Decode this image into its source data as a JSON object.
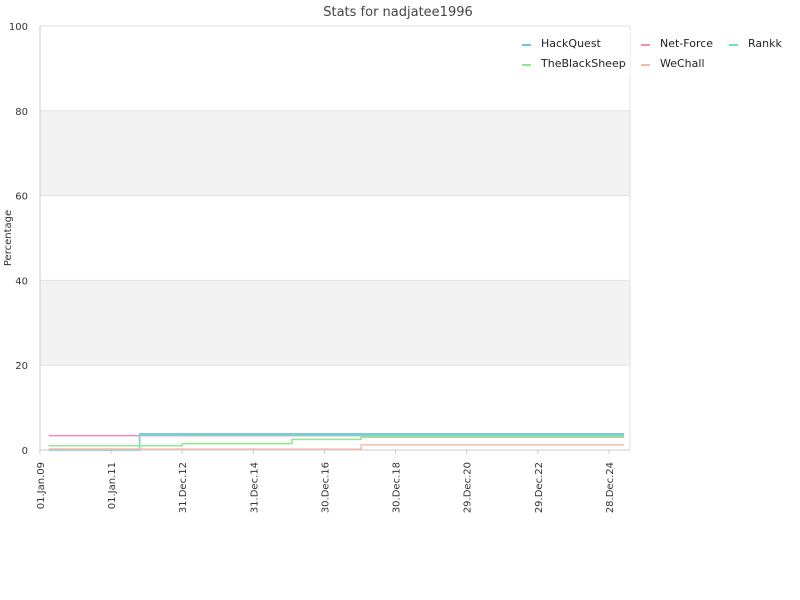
{
  "chart_data": {
    "type": "line",
    "title": "Stats for nadjatee1996",
    "xlabel": "",
    "ylabel": "Percentage",
    "ylim": [
      0,
      100
    ],
    "yticks": [
      0,
      20,
      40,
      60,
      80,
      100
    ],
    "xlim": [
      "2009-01-01",
      "2025-08-01"
    ],
    "xticks": [
      {
        "date": "2009-01-01",
        "label": "01.Jan.09"
      },
      {
        "date": "2011-01-01",
        "label": "01.Jan.11"
      },
      {
        "date": "2012-12-31",
        "label": "31.Dec.12"
      },
      {
        "date": "2014-12-31",
        "label": "31.Dec.14"
      },
      {
        "date": "2016-12-30",
        "label": "30.Dec.16"
      },
      {
        "date": "2018-12-30",
        "label": "30.Dec.18"
      },
      {
        "date": "2020-12-29",
        "label": "29.Dec.20"
      },
      {
        "date": "2022-12-29",
        "label": "29.Dec.22"
      },
      {
        "date": "2024-12-28",
        "label": "28.Dec.24"
      }
    ],
    "grid": true,
    "legend_position": "top-right",
    "step": true,
    "series": [
      {
        "name": "HackQuest",
        "color": "#7ab8e8",
        "points": [
          [
            "2009-04-01",
            0
          ],
          [
            "2011-10-20",
            3.8
          ],
          [
            "2025-06-01",
            3.8
          ]
        ]
      },
      {
        "name": "Net-Force",
        "color": "#f08cb8",
        "points": [
          [
            "2009-04-01",
            3.4
          ],
          [
            "2025-06-01",
            3.4
          ]
        ]
      },
      {
        "name": "Rankk",
        "color": "#6ee0c8",
        "points": [
          [
            "2009-04-01",
            0.2
          ],
          [
            "2011-10-20",
            0.2
          ],
          [
            "2011-10-21",
            3.5
          ],
          [
            "2025-06-01",
            3.5
          ]
        ]
      },
      {
        "name": "TheBlackSheep",
        "color": "#90e890",
        "points": [
          [
            "2009-04-01",
            1.0
          ],
          [
            "2012-12-31",
            1.5
          ],
          [
            "2016-02-01",
            2.5
          ],
          [
            "2018-01-10",
            3.0
          ],
          [
            "2025-06-01",
            3.0
          ]
        ]
      },
      {
        "name": "WeChall",
        "color": "#f8b8b0",
        "points": [
          [
            "2009-04-01",
            0.2
          ],
          [
            "2018-01-10",
            1.2
          ],
          [
            "2025-06-01",
            1.2
          ]
        ]
      }
    ]
  }
}
